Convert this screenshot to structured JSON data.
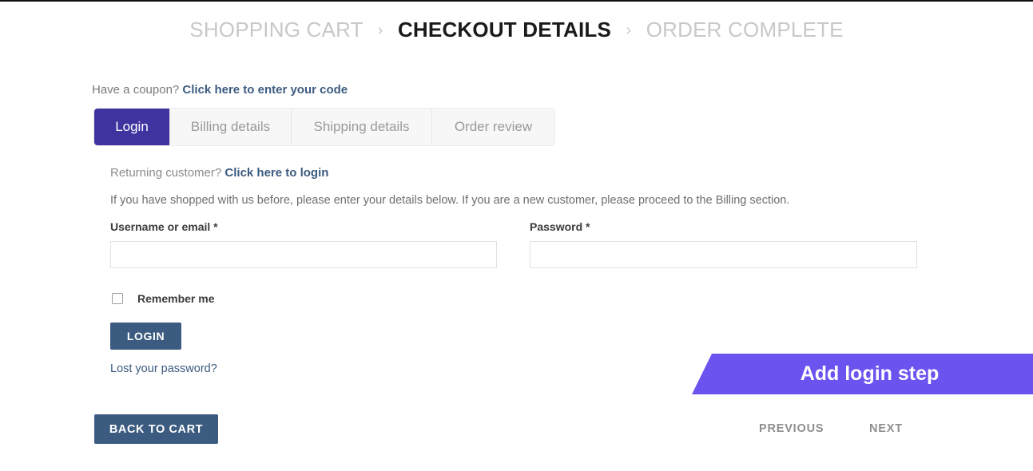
{
  "breadcrumb": {
    "steps": [
      {
        "label": "SHOPPING CART",
        "state": "done"
      },
      {
        "label": "CHECKOUT DETAILS",
        "state": "current"
      },
      {
        "label": "ORDER COMPLETE",
        "state": "upcoming"
      }
    ],
    "separator": "›"
  },
  "coupon": {
    "prompt": "Have a coupon?",
    "link_label": "Click here to enter your code"
  },
  "tabs": [
    {
      "label": "Login",
      "active": true
    },
    {
      "label": "Billing details",
      "active": false
    },
    {
      "label": "Shipping details",
      "active": false
    },
    {
      "label": "Order review",
      "active": false
    }
  ],
  "login_panel": {
    "returning_prompt": "Returning customer?",
    "returning_link_label": "Click here to login",
    "description": "If you have shopped with us before, please enter your details below. If you are a new customer, please proceed to the Billing section.",
    "username_label": "Username or email *",
    "username_value": "",
    "username_placeholder": "",
    "password_label": "Password *",
    "password_value": "",
    "password_placeholder": "",
    "remember_label": "Remember me",
    "remember_checked": false,
    "login_button_label": "LOGIN",
    "lost_password_label": "Lost your password?"
  },
  "ribbon": {
    "text": "Add login step"
  },
  "footer": {
    "back_to_cart_label": "BACK TO CART",
    "previous_label": "PREVIOUS",
    "next_label": "NEXT"
  },
  "colors": {
    "active_tab_purple": "#3f33a0",
    "ribbon_purple": "#6b53f0",
    "button_slate": "#3c5b80",
    "link_slate": "#3c5b80",
    "muted_text": "#c8c8c8",
    "tab_inactive_bg": "#f7f7f7"
  }
}
